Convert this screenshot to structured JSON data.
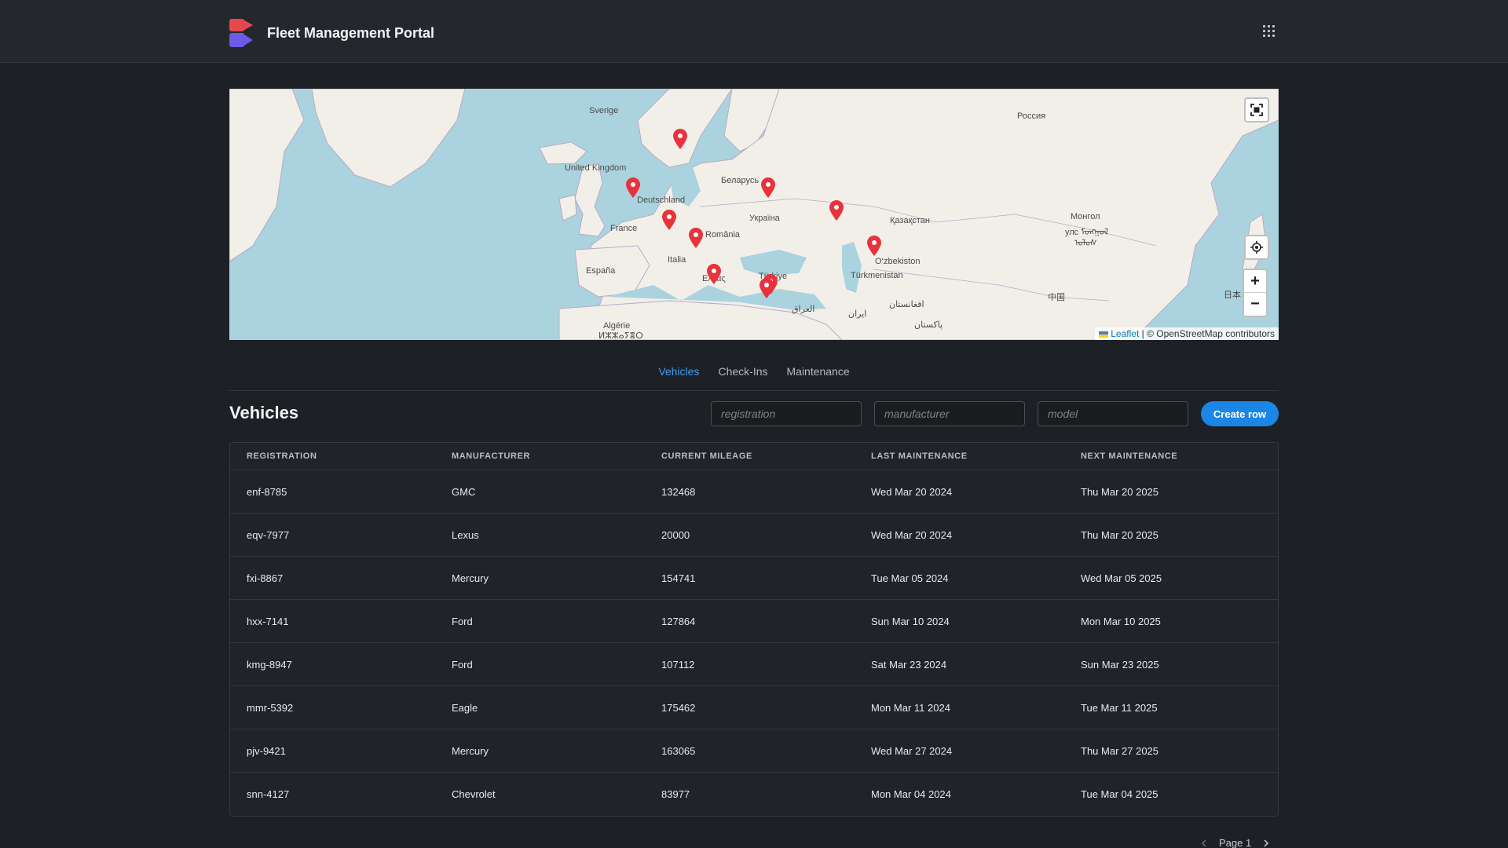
{
  "header": {
    "title": "Fleet Management Portal",
    "apps_icon": "apps-grid-icon"
  },
  "map": {
    "labels": [
      {
        "text": "Sverige"
      },
      {
        "text": "Россия"
      },
      {
        "text": "United Kingdom"
      },
      {
        "text": "Беларусь"
      },
      {
        "text": "Deutschland"
      },
      {
        "text": "France"
      },
      {
        "text": "Україна"
      },
      {
        "text": "România"
      },
      {
        "text": "Қазақстан"
      },
      {
        "text": "Монгол"
      },
      {
        "text": "улс ᠮᠣᠩᠭᠣᠯ"
      },
      {
        "text": "ᠤᠯᠤᠰ"
      },
      {
        "text": "Italia"
      },
      {
        "text": "O‘zbekiston"
      },
      {
        "text": "España"
      },
      {
        "text": "Türkmenistan"
      },
      {
        "text": "Türkiye"
      },
      {
        "text": "Ελλάς"
      },
      {
        "text": "中国"
      },
      {
        "text": "日本"
      },
      {
        "text": "العراق"
      },
      {
        "text": "ایران"
      },
      {
        "text": "افغانستان"
      },
      {
        "text": "Algérie"
      },
      {
        "text": "ⵍⵣⵣⴰⵢⴻⵔ"
      },
      {
        "text": "پاکستان"
      }
    ],
    "fullscreen_icon": "fullscreen-icon",
    "locate_icon": "locate-icon",
    "zoom_in": "+",
    "zoom_out": "−",
    "attribution_leaflet": "Leaflet",
    "attribution_rest": "| © OpenStreetMap contributors"
  },
  "tabs": [
    {
      "label": "Vehicles",
      "active": true
    },
    {
      "label": "Check-Ins",
      "active": false
    },
    {
      "label": "Maintenance",
      "active": false
    }
  ],
  "section": {
    "title": "Vehicles",
    "filters": [
      {
        "placeholder": "registration"
      },
      {
        "placeholder": "manufacturer"
      },
      {
        "placeholder": "model"
      }
    ],
    "create_label": "Create row"
  },
  "table": {
    "columns": [
      "REGISTRATION",
      "MANUFACTURER",
      "CURRENT MILEAGE",
      "LAST MAINTENANCE",
      "NEXT MAINTENANCE"
    ],
    "rows": [
      [
        "enf-8785",
        "GMC",
        "132468",
        "Wed Mar 20 2024",
        "Thu Mar 20 2025"
      ],
      [
        "eqv-7977",
        "Lexus",
        "20000",
        "Wed Mar 20 2024",
        "Thu Mar 20 2025"
      ],
      [
        "fxi-8867",
        "Mercury",
        "154741",
        "Tue Mar 05 2024",
        "Wed Mar 05 2025"
      ],
      [
        "hxx-7141",
        "Ford",
        "127864",
        "Sun Mar 10 2024",
        "Mon Mar 10 2025"
      ],
      [
        "kmg-8947",
        "Ford",
        "107112",
        "Sat Mar 23 2024",
        "Sun Mar 23 2025"
      ],
      [
        "mmr-5392",
        "Eagle",
        "175462",
        "Mon Mar 11 2024",
        "Tue Mar 11 2025"
      ],
      [
        "pjv-9421",
        "Mercury",
        "163065",
        "Wed Mar 27 2024",
        "Thu Mar 27 2025"
      ],
      [
        "snn-4127",
        "Chevrolet",
        "83977",
        "Mon Mar 04 2024",
        "Tue Mar 04 2025"
      ]
    ]
  },
  "pagination": {
    "label": "Page 1"
  },
  "colors": {
    "accent": "#1c86e6",
    "tab_active": "#3b9eff",
    "pin": "#e8323c",
    "background": "#1d2024"
  }
}
